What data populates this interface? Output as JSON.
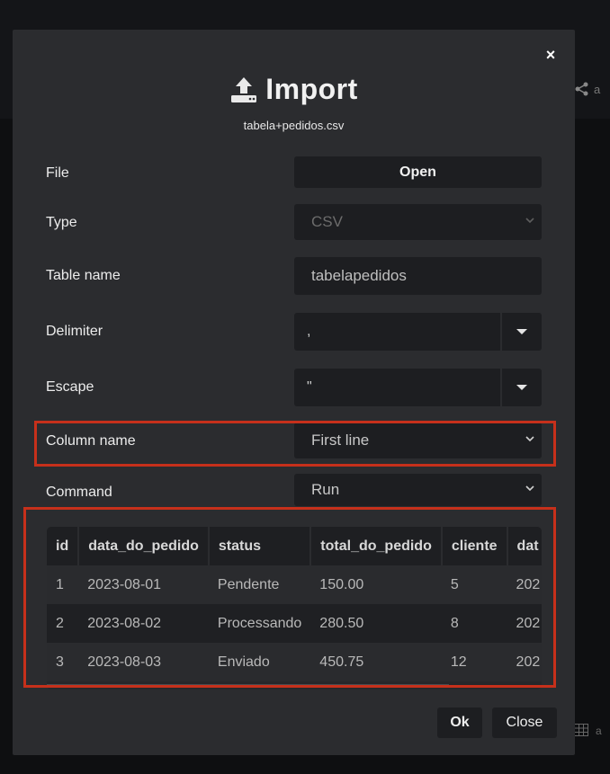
{
  "dialog": {
    "title": "Import",
    "filename": "tabela+pedidos.csv",
    "close_glyph": "×",
    "icon": "upload-icon"
  },
  "form": {
    "file": {
      "label": "File",
      "button": "Open"
    },
    "type": {
      "label": "Type",
      "value": "CSV"
    },
    "table_name": {
      "label": "Table name",
      "value": "tabelapedidos"
    },
    "delimiter": {
      "label": "Delimiter",
      "value": ","
    },
    "escape": {
      "label": "Escape",
      "value": "\""
    },
    "column_name": {
      "label": "Column name",
      "value": "First line"
    },
    "command": {
      "label": "Command",
      "value": "Run"
    }
  },
  "preview": {
    "columns": [
      "id",
      "data_do_pedido",
      "status",
      "total_do_pedido",
      "cliente",
      "dat"
    ],
    "rows": [
      [
        "1",
        "2023-08-01",
        "Pendente",
        "150.00",
        "5",
        "202"
      ],
      [
        "2",
        "2023-08-02",
        "Processando",
        "280.50",
        "8",
        "202"
      ],
      [
        "3",
        "2023-08-03",
        "Enviado",
        "450.75",
        "12",
        "202"
      ]
    ]
  },
  "footer": {
    "ok": "Ok",
    "close": "Close"
  },
  "background": {
    "partial_letter": "a"
  },
  "colors": {
    "highlight": "#c6301b",
    "modal_bg": "#2b2c2f",
    "field_bg": "#1d1e21"
  }
}
